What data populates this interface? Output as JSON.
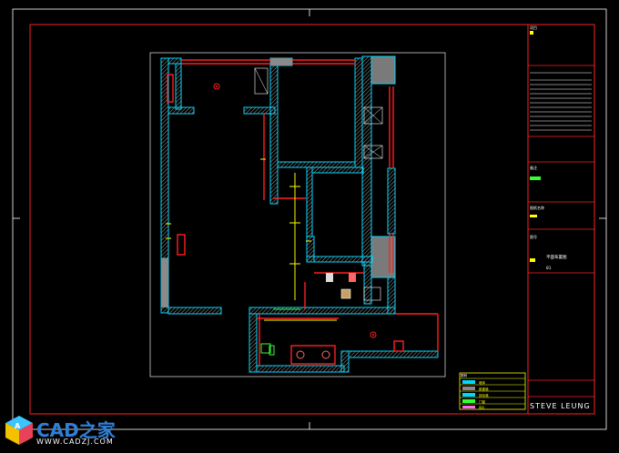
{
  "title_block": {
    "top_label": "项目",
    "section_1": "备注",
    "section_2": "图纸名称",
    "section_3": "图号",
    "dwg_title": "平面布置图",
    "dwg_no": "01",
    "firm_name": "STEVE LEUNG"
  },
  "legend": {
    "heading": "图例",
    "items": [
      {
        "label": "墙体",
        "color": "#00d8ff"
      },
      {
        "label": "新建墙",
        "color": "#888888"
      },
      {
        "label": "拆除墙",
        "color": "#00d8ff"
      },
      {
        "label": "门窗",
        "color": "#33ff33"
      },
      {
        "label": "家具",
        "color": "#ff66ff"
      }
    ]
  },
  "watermark": {
    "brand": "CAD之家",
    "url": "WWW.CADZJ.COM"
  },
  "colors": {
    "frame": "#ff2020",
    "wall": "#00d8ff",
    "hatch": "#7a7a7a",
    "dim": "#ffff00",
    "paper": "#ffffff"
  }
}
